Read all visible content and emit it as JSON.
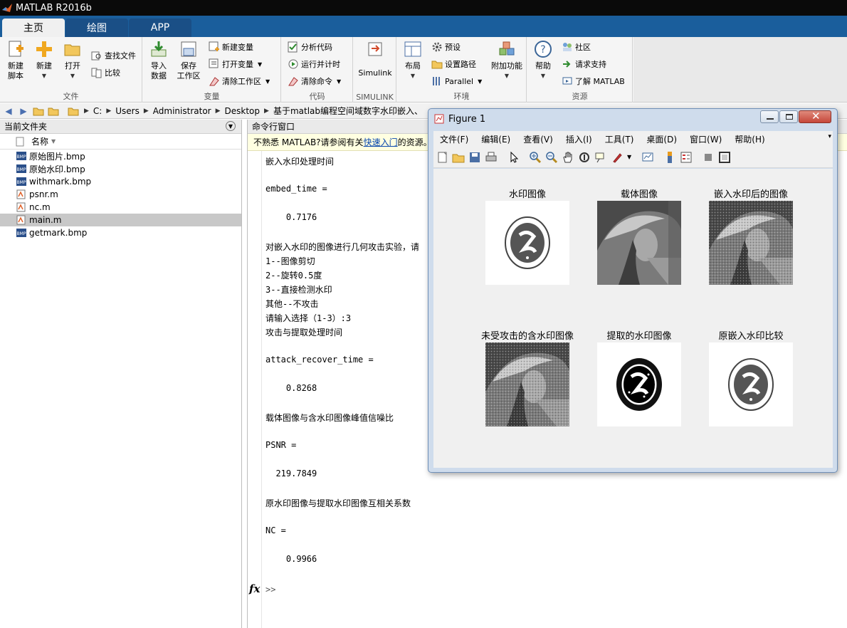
{
  "app": {
    "title": "MATLAB R2016b"
  },
  "tabs": [
    {
      "label": "主页"
    },
    {
      "label": "绘图"
    },
    {
      "label": "APP"
    }
  ],
  "ribbon": {
    "file": {
      "label": "文件",
      "new_script": "新建\n脚本",
      "new": "新建",
      "open": "打开",
      "find_files": "查找文件",
      "compare": "比较"
    },
    "variable": {
      "label": "变量",
      "import_data": "导入\n数据",
      "save_workspace": "保存\n工作区",
      "new_variable": "新建变量",
      "open_variable": "打开变量",
      "clear_workspace": "清除工作区"
    },
    "code": {
      "label": "代码",
      "analyze": "分析代码",
      "run_time": "运行并计时",
      "clear_commands": "清除命令"
    },
    "simulink": {
      "label": "SIMULINK",
      "simulink": "Simulink"
    },
    "environment": {
      "label": "环境",
      "layout": "布局",
      "preferences": "预设",
      "set_path": "设置路径",
      "parallel": "Parallel",
      "addons": "附加功能"
    },
    "resources": {
      "label": "资源",
      "help": "帮助",
      "community": "社区",
      "request_support": "请求支持",
      "learn_matlab": "了解 MATLAB"
    }
  },
  "address": {
    "parts": [
      "C:",
      "Users",
      "Administrator",
      "Desktop",
      "基于matlab编程空间域数字水印嵌入、"
    ]
  },
  "current_folder": {
    "title": "当前文件夹",
    "column": "名称",
    "files": [
      {
        "name": "原始图片.bmp",
        "type": "bmp"
      },
      {
        "name": "原始水印.bmp",
        "type": "bmp"
      },
      {
        "name": "withmark.bmp",
        "type": "bmp"
      },
      {
        "name": "psnr.m",
        "type": "m"
      },
      {
        "name": "nc.m",
        "type": "m"
      },
      {
        "name": "main.m",
        "type": "m",
        "selected": true
      },
      {
        "name": "getmark.bmp",
        "type": "bmp"
      }
    ]
  },
  "command_window": {
    "title": "命令行窗口",
    "info_prefix": "不熟悉 MATLAB?请参阅有关",
    "info_link": "快速入门",
    "info_suffix": "的资源。",
    "lines": [
      "嵌入水印处理时间",
      "",
      "embed_time =",
      "",
      "    0.7176",
      "",
      "对嵌入水印的图像进行几何攻击实验，请",
      "1--图像剪切",
      "2--旋转0.5度",
      "3--直接检测水印",
      "其他--不攻击",
      "请输入选择（1-3）:3",
      "攻击与提取处理时间",
      "",
      "attack_recover_time =",
      "",
      "    0.8268",
      "",
      "载体图像与含水印图像峰值信噪比",
      "",
      "PSNR =",
      "",
      "  219.7849",
      "",
      "原水印图像与提取水印图像互相关系数",
      "",
      "NC =",
      "",
      "    0.9966",
      ""
    ],
    "prompt": ">>",
    "fx": "fx"
  },
  "figure": {
    "title": "Figure 1",
    "menu": [
      "文件(F)",
      "编辑(E)",
      "查看(V)",
      "插入(I)",
      "工具(T)",
      "桌面(D)",
      "窗口(W)",
      "帮助(H)"
    ],
    "subplots": [
      {
        "title": "水印图像"
      },
      {
        "title": "载体图像"
      },
      {
        "title": "嵌入水印后的图像"
      },
      {
        "title": "未受攻击的含水印图像"
      },
      {
        "title": "提取的水印图像"
      },
      {
        "title": "原嵌入水印比较"
      }
    ]
  }
}
